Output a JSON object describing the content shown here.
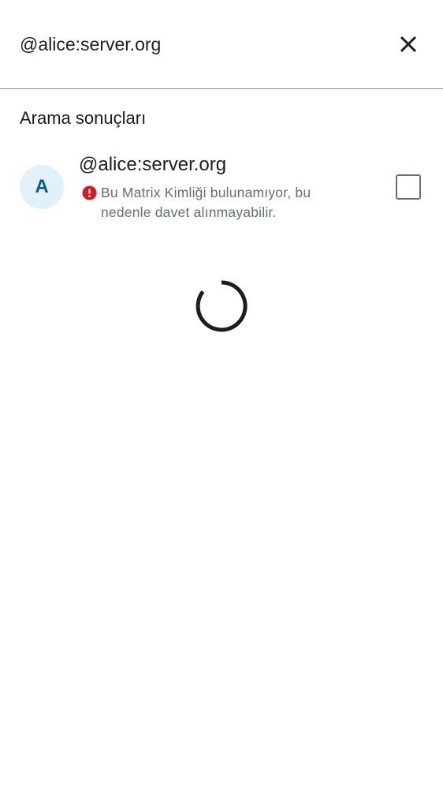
{
  "search": {
    "value": "@alice:server.org",
    "close_icon": "close-icon"
  },
  "results": {
    "section_title": "Arama sonuçları",
    "items": [
      {
        "avatar_letter": "A",
        "name": "@alice:server.org",
        "warning_icon": "error-circle-icon",
        "warning_text": "Bu Matrix Kimliği bulunamıyor, bu nedenle davet alınmayabilir.",
        "selected": false
      }
    ]
  },
  "loading": {
    "icon": "loading-spinner"
  },
  "colors": {
    "avatar_bg": "#e0f1f7",
    "avatar_text": "#0d5a8a",
    "error_red": "#d51928",
    "secondary_text": "#656d77",
    "primary_text": "#1b1d22"
  }
}
